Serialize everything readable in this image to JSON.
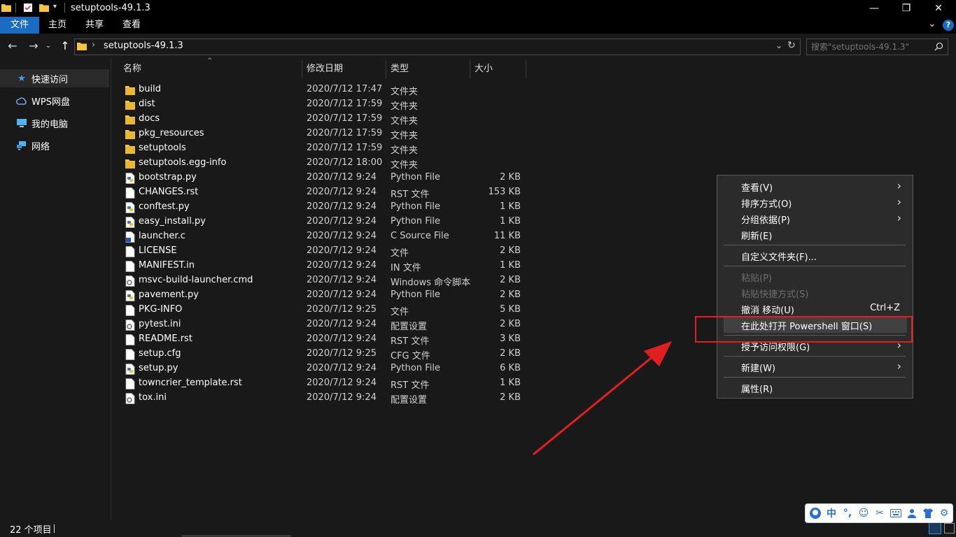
{
  "window": {
    "title": "setuptools-49.1.3",
    "minimize_glyph": "—",
    "maximize_glyph": "❐",
    "close_glyph": "✕"
  },
  "ribbon": {
    "tabs": [
      "文件",
      "主页",
      "共享",
      "查看"
    ],
    "expand_glyph": "⌄",
    "help_glyph": "?"
  },
  "address": {
    "path": "setuptools-49.1.3",
    "separator": "›",
    "search_placeholder": "搜索\"setuptools-49.1.3\""
  },
  "nav_pane": {
    "items": [
      {
        "label": "快速访问",
        "icon": "star-icon"
      },
      {
        "label": "WPS网盘",
        "icon": "cloud-icon"
      },
      {
        "label": "我的电脑",
        "icon": "computer-icon"
      },
      {
        "label": "网络",
        "icon": "network-icon"
      }
    ]
  },
  "columns": {
    "name": "名称",
    "date": "修改日期",
    "type": "类型",
    "size": "大小"
  },
  "files": [
    {
      "name": "build",
      "date": "2020/7/12 17:47",
      "type": "文件夹",
      "size": "",
      "icon": "folder"
    },
    {
      "name": "dist",
      "date": "2020/7/12 17:59",
      "type": "文件夹",
      "size": "",
      "icon": "folder"
    },
    {
      "name": "docs",
      "date": "2020/7/12 17:59",
      "type": "文件夹",
      "size": "",
      "icon": "folder"
    },
    {
      "name": "pkg_resources",
      "date": "2020/7/12 17:59",
      "type": "文件夹",
      "size": "",
      "icon": "folder"
    },
    {
      "name": "setuptools",
      "date": "2020/7/12 17:59",
      "type": "文件夹",
      "size": "",
      "icon": "folder"
    },
    {
      "name": "setuptools.egg-info",
      "date": "2020/7/12 18:00",
      "type": "文件夹",
      "size": "",
      "icon": "folder"
    },
    {
      "name": "bootstrap.py",
      "date": "2020/7/12 9:24",
      "type": "Python File",
      "size": "2 KB",
      "icon": "python"
    },
    {
      "name": "CHANGES.rst",
      "date": "2020/7/12 9:24",
      "type": "RST 文件",
      "size": "153 KB",
      "icon": "file"
    },
    {
      "name": "conftest.py",
      "date": "2020/7/12 9:24",
      "type": "Python File",
      "size": "1 KB",
      "icon": "python"
    },
    {
      "name": "easy_install.py",
      "date": "2020/7/12 9:24",
      "type": "Python File",
      "size": "1 KB",
      "icon": "python"
    },
    {
      "name": "launcher.c",
      "date": "2020/7/12 9:24",
      "type": "C Source File",
      "size": "11 KB",
      "icon": "csource"
    },
    {
      "name": "LICENSE",
      "date": "2020/7/12 9:24",
      "type": "文件",
      "size": "2 KB",
      "icon": "file"
    },
    {
      "name": "MANIFEST.in",
      "date": "2020/7/12 9:24",
      "type": "IN 文件",
      "size": "1 KB",
      "icon": "file"
    },
    {
      "name": "msvc-build-launcher.cmd",
      "date": "2020/7/12 9:24",
      "type": "Windows 命令脚本",
      "size": "2 KB",
      "icon": "gear"
    },
    {
      "name": "pavement.py",
      "date": "2020/7/12 9:24",
      "type": "Python File",
      "size": "2 KB",
      "icon": "python"
    },
    {
      "name": "PKG-INFO",
      "date": "2020/7/12 9:25",
      "type": "文件",
      "size": "5 KB",
      "icon": "file"
    },
    {
      "name": "pytest.ini",
      "date": "2020/7/12 9:24",
      "type": "配置设置",
      "size": "2 KB",
      "icon": "gear"
    },
    {
      "name": "README.rst",
      "date": "2020/7/12 9:24",
      "type": "RST 文件",
      "size": "3 KB",
      "icon": "file"
    },
    {
      "name": "setup.cfg",
      "date": "2020/7/12 9:25",
      "type": "CFG 文件",
      "size": "2 KB",
      "icon": "file"
    },
    {
      "name": "setup.py",
      "date": "2020/7/12 9:24",
      "type": "Python File",
      "size": "6 KB",
      "icon": "python"
    },
    {
      "name": "towncrier_template.rst",
      "date": "2020/7/12 9:24",
      "type": "RST 文件",
      "size": "1 KB",
      "icon": "file"
    },
    {
      "name": "tox.ini",
      "date": "2020/7/12 9:24",
      "type": "配置设置",
      "size": "2 KB",
      "icon": "gear"
    }
  ],
  "context_menu": {
    "view": "查看(V)",
    "sort": "排序方式(O)",
    "group": "分组依据(P)",
    "refresh": "刷新(E)",
    "customize": "自定义文件夹(F)...",
    "paste": "粘贴(P)",
    "paste_shortcut": "粘贴快捷方式(S)",
    "undo_move": "撤消 移动(U)",
    "undo_shortcut": "Ctrl+Z",
    "open_powershell": "在此处打开 Powershell 窗口(S)",
    "grant_access": "授予访问权限(G)",
    "new": "新建(W)",
    "properties": "属性(R)",
    "submenu_arrow": "›"
  },
  "status": {
    "item_count": "22 个项目"
  },
  "ime_toolbar": {
    "lang": "中",
    "punct": "°,",
    "icons": [
      "chinese-lang-icon",
      "punctuation-icon",
      "emoji-icon",
      "scissors-icon",
      "keyboard-icon",
      "person-icon",
      "shirt-icon",
      "gear-icon"
    ]
  },
  "colors": {
    "accent": "#1a6bc2",
    "highlight": "#e02020",
    "folder": "#f5c542",
    "background": "#191919",
    "menu_bg": "#2b2b2b"
  }
}
